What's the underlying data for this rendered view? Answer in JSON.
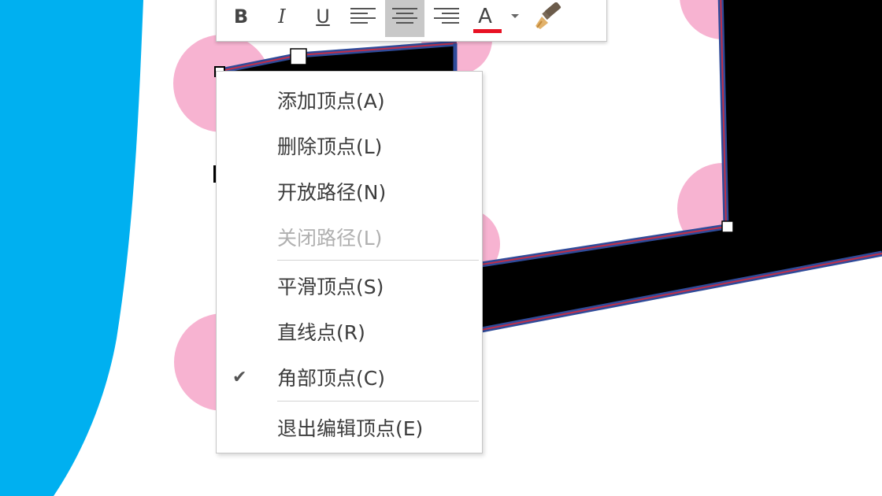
{
  "toolbar": {
    "bold_label": "B",
    "italic_label": "I",
    "underline_label": "U",
    "align_left_icon": "align-left-icon",
    "align_center_icon": "align-center-icon",
    "align_right_icon": "align-right-icon",
    "font_color_label": "A",
    "font_color_bar_color": "#e81123",
    "format_painter_icon": "format-painter-icon"
  },
  "context_menu": {
    "items": [
      {
        "label": "添加顶点(A)",
        "enabled": true,
        "checked": false
      },
      {
        "label": "删除顶点(L)",
        "enabled": true,
        "checked": false
      },
      {
        "label": "开放路径(N)",
        "enabled": true,
        "checked": false
      },
      {
        "label": "关闭路径(L)",
        "enabled": false,
        "checked": false
      },
      {
        "label": "平滑顶点(S)",
        "enabled": true,
        "checked": false
      },
      {
        "label": "直线点(R)",
        "enabled": true,
        "checked": false
      },
      {
        "label": "角部顶点(C)",
        "enabled": true,
        "checked": true
      },
      {
        "label": "退出编辑顶点(E)",
        "enabled": true,
        "checked": false
      }
    ],
    "check_glyph": "✔"
  },
  "colors": {
    "slide_blue": "#00b0f0",
    "pink_dot": "#f7b3d1",
    "shape_fill": "#000000",
    "shape_outline_blue": "#2f4b9a",
    "shape_outline_red": "#c0304a"
  }
}
